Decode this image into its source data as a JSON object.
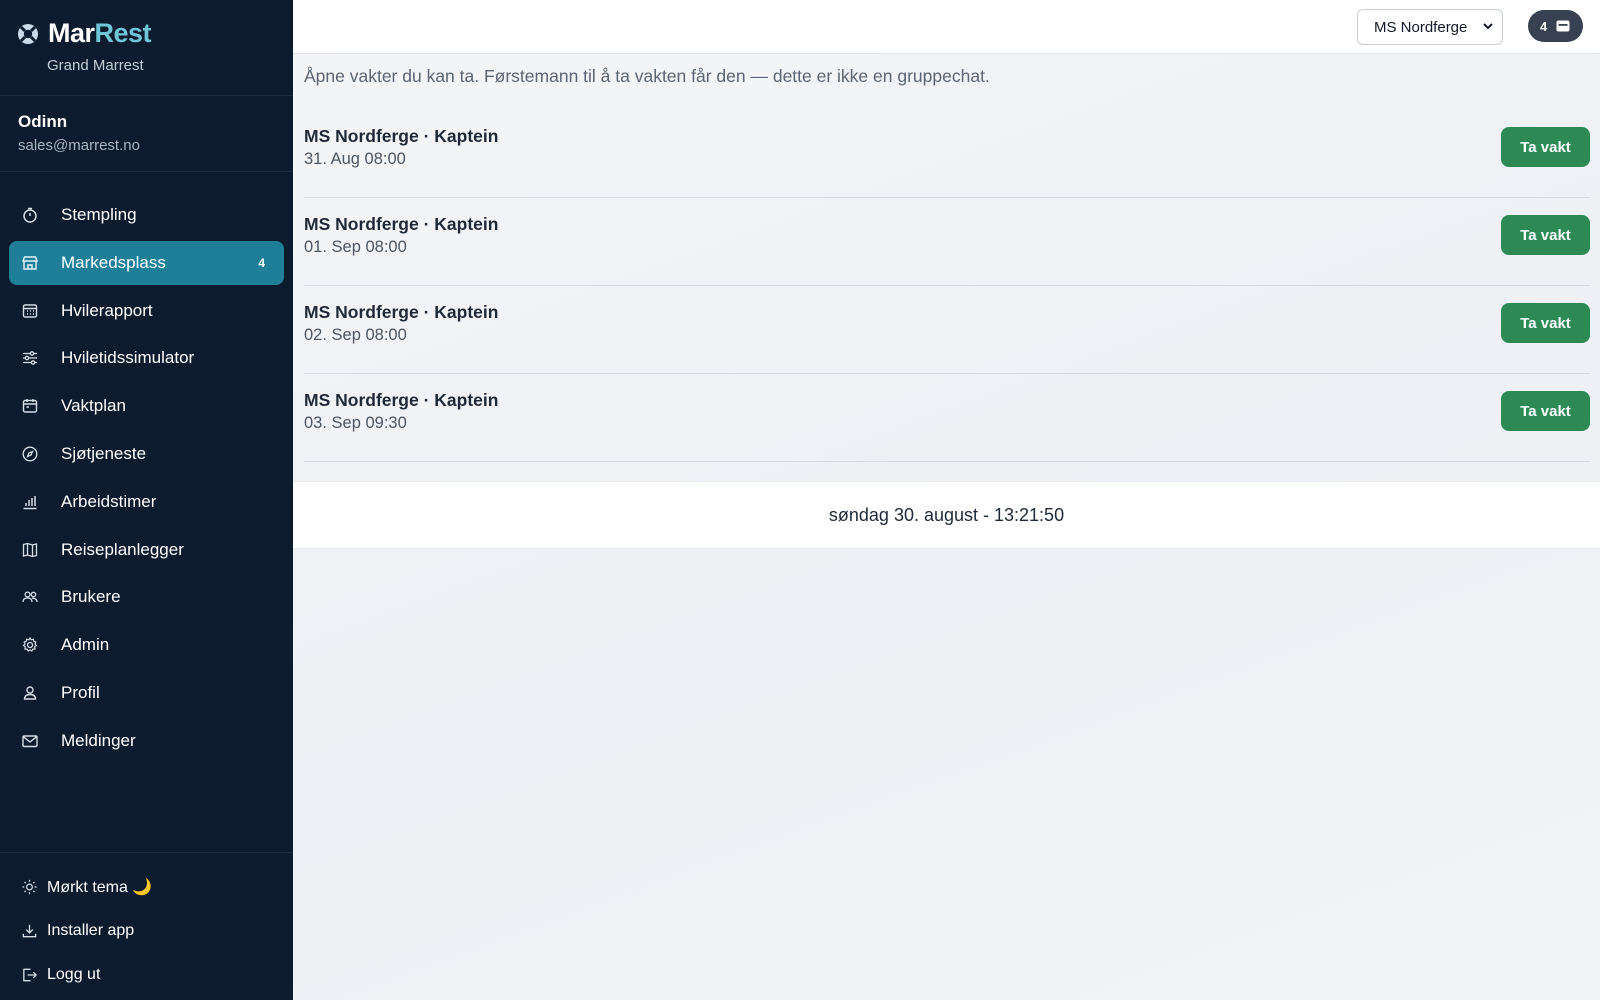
{
  "app": {
    "brand_primary": "Mar",
    "brand_secondary": "Rest",
    "organization": "Grand Marrest"
  },
  "user": {
    "name": "Odinn",
    "email": "sales@marrest.no"
  },
  "sidebar": {
    "items": [
      {
        "label": "Stempling",
        "icon": "stopwatch-icon",
        "active": false
      },
      {
        "label": "Markedsplass",
        "icon": "store-icon",
        "active": true,
        "badge": "4"
      },
      {
        "label": "Hvilerapport",
        "icon": "calendar-grid-icon",
        "active": false
      },
      {
        "label": "Hviletidssimulator",
        "icon": "sliders-icon",
        "active": false
      },
      {
        "label": "Vaktplan",
        "icon": "calendar-icon",
        "active": false
      },
      {
        "label": "Sjøtjeneste",
        "icon": "compass-icon",
        "active": false
      },
      {
        "label": "Arbeidstimer",
        "icon": "bar-chart-icon",
        "active": false
      },
      {
        "label": "Reiseplanlegger",
        "icon": "map-icon",
        "active": false
      },
      {
        "label": "Brukere",
        "icon": "users-icon",
        "active": false
      },
      {
        "label": "Admin",
        "icon": "gear-icon",
        "active": false
      },
      {
        "label": "Profil",
        "icon": "user-icon",
        "active": false
      },
      {
        "label": "Meldinger",
        "icon": "mail-icon",
        "active": false
      }
    ],
    "bottom": [
      {
        "label": "Mørkt tema 🌙",
        "icon": "sun-icon"
      },
      {
        "label": "Installer app",
        "icon": "download-icon"
      },
      {
        "label": "Logg ut",
        "icon": "logout-icon"
      }
    ]
  },
  "topbar": {
    "vessel_selected": "MS Nordferge",
    "notification_count": "4"
  },
  "main": {
    "intro": "Åpne vakter du kan ta. Førstemann til å ta vakten får den — dette er ikke en gruppechat.",
    "shifts": [
      {
        "title": "MS Nordferge · Kaptein",
        "date": "31. Aug 08:00",
        "button": "Ta vakt"
      },
      {
        "title": "MS Nordferge · Kaptein",
        "date": "01. Sep 08:00",
        "button": "Ta vakt"
      },
      {
        "title": "MS Nordferge · Kaptein",
        "date": "02. Sep 08:00",
        "button": "Ta vakt"
      },
      {
        "title": "MS Nordferge · Kaptein",
        "date": "03. Sep 09:30",
        "button": "Ta vakt"
      }
    ],
    "clock": "søndag 30. august - 13:21:50"
  },
  "colors": {
    "sidebar_bg": "#0d1b2e",
    "active_item": "#1f7f99",
    "brand_accent": "#6fc6d6",
    "take_button": "#2e8a55"
  }
}
